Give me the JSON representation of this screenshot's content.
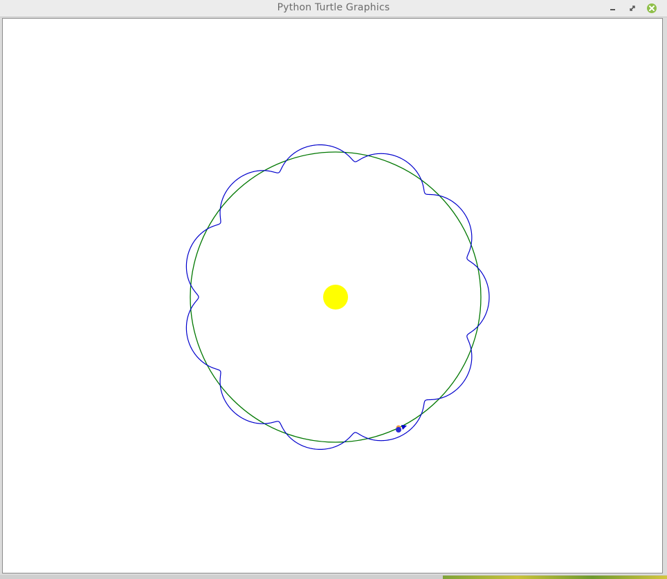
{
  "window": {
    "title": "Python Turtle Graphics",
    "controls": {
      "minimize_icon": "minimize-icon",
      "maximize_icon": "maximize-icon",
      "close_icon": "close-icon"
    }
  },
  "canvas": {
    "background": "#ffffff",
    "sun_color": "#ffff00",
    "orbit_color": "#007700",
    "epicycle_color": "#0000cc",
    "earth_color": "#2b2bd6",
    "moon_color": "#f0a040",
    "turtle_head_color": "#0000cc"
  }
}
